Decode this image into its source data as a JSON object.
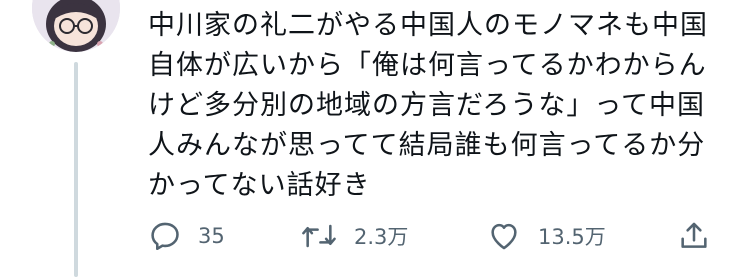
{
  "tweet": {
    "text_lines": [
      "中川家の礼二がやる中国人のモノマネも中国",
      "自体が広いから「俺は何言ってるかわからん",
      "けど多分別の地域の方言だろうな」って中国",
      "人みんなが思ってて結局誰も何言ってるか分",
      "かってない話好き"
    ]
  },
  "actions": {
    "reply": {
      "icon": "reply-icon",
      "count": "35"
    },
    "retweet": {
      "icon": "retweet-icon",
      "count": "2.3万"
    },
    "like": {
      "icon": "heart-icon",
      "count": "13.5万"
    },
    "share": {
      "icon": "share-icon"
    }
  },
  "colors": {
    "text": "#0f1419",
    "secondary": "#536471",
    "thread_line": "#cfd9de"
  }
}
